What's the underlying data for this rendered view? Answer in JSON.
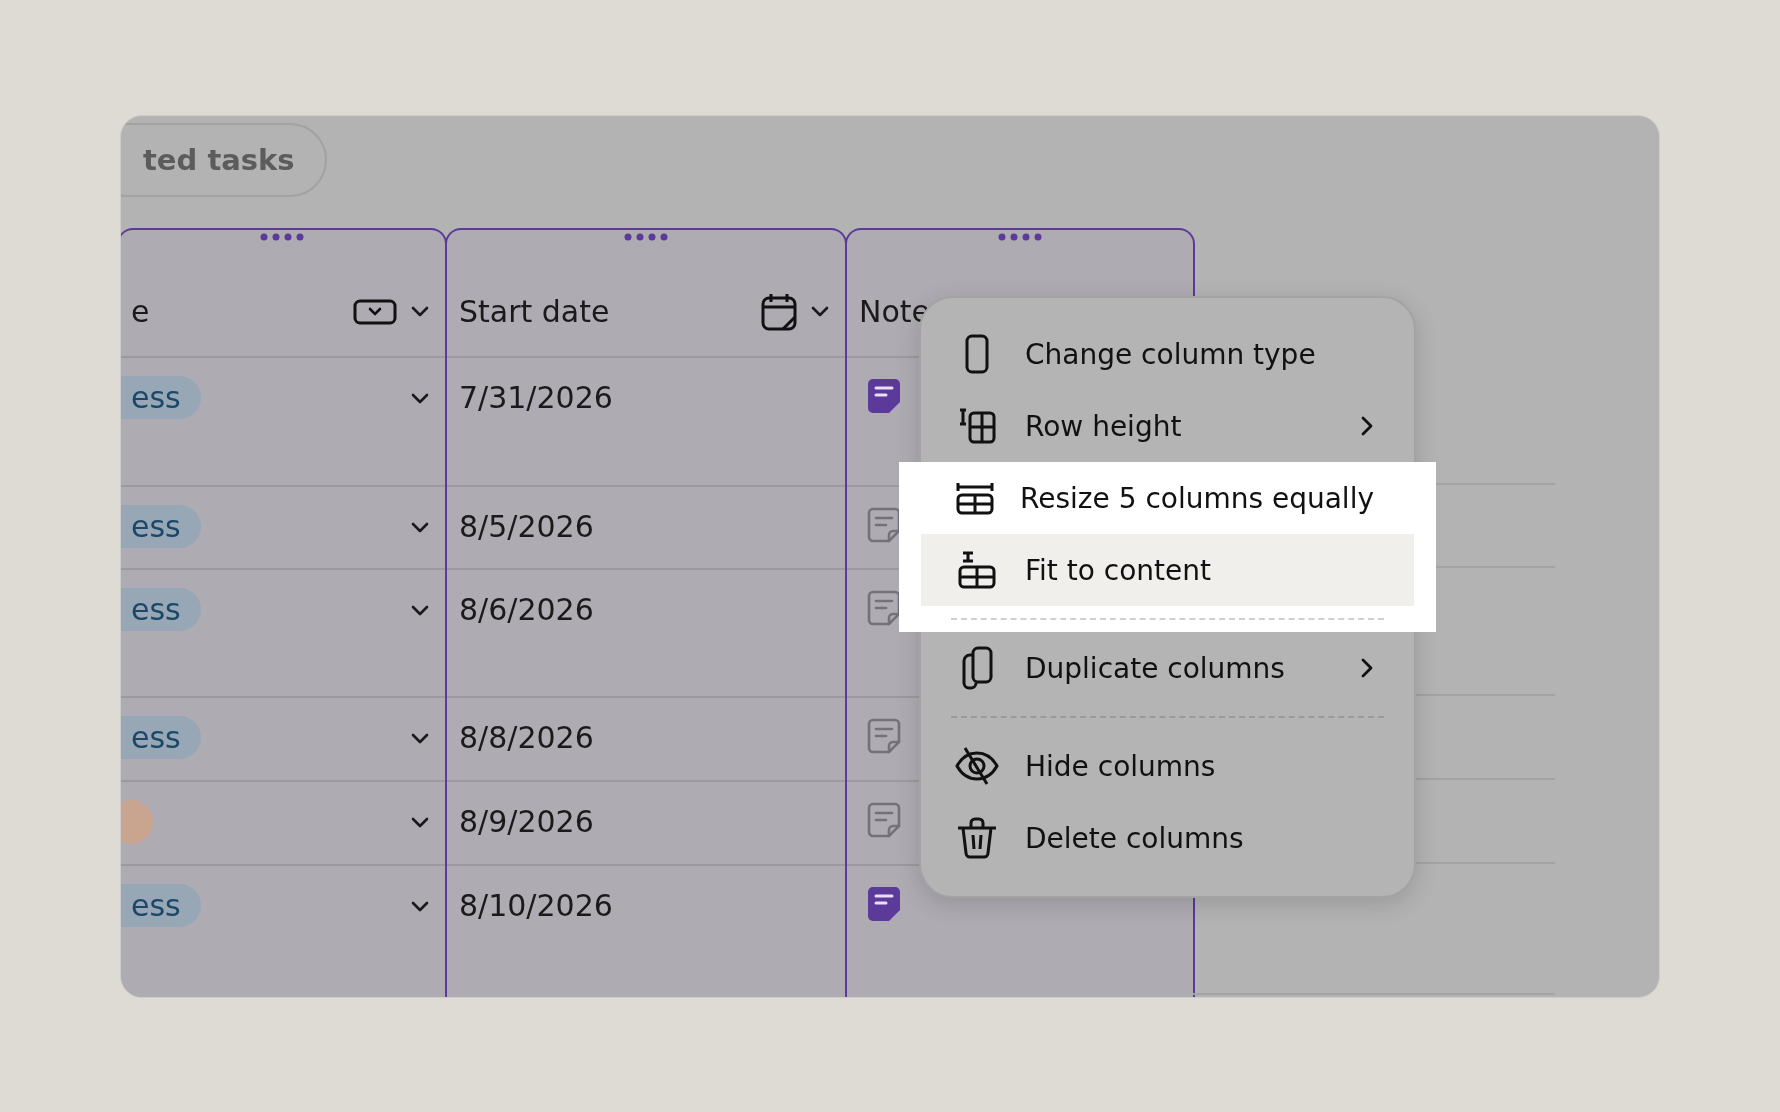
{
  "filter_pill": {
    "label": "ted tasks"
  },
  "columns": [
    {
      "header": "e",
      "selected": true,
      "cells": [
        {
          "kind": "status",
          "text": "ess"
        },
        {
          "kind": "status",
          "text": "ess"
        },
        {
          "kind": "status",
          "text": "ess"
        },
        {
          "kind": "status",
          "text": "ess"
        },
        {
          "kind": "dot",
          "color": "#c9a48e"
        },
        {
          "kind": "status",
          "text": "ess"
        }
      ]
    },
    {
      "header": "Start date",
      "selected": true,
      "cells": [
        {
          "kind": "date",
          "text": "7/31/2026"
        },
        {
          "kind": "date",
          "text": "8/5/2026"
        },
        {
          "kind": "date",
          "text": "8/6/2026"
        },
        {
          "kind": "date",
          "text": "8/8/2026"
        },
        {
          "kind": "date",
          "text": "8/9/2026"
        },
        {
          "kind": "date",
          "text": "8/10/2026"
        }
      ]
    },
    {
      "header": "Note",
      "selected": true,
      "cells": [
        {
          "kind": "note",
          "filled": true
        },
        {
          "kind": "note",
          "filled": false
        },
        {
          "kind": "note",
          "filled": false
        },
        {
          "kind": "note",
          "filled": false
        },
        {
          "kind": "note",
          "filled": false
        },
        {
          "kind": "note",
          "filled": true
        }
      ]
    }
  ],
  "menu": {
    "items": [
      {
        "kind": "item",
        "label": "Change column type",
        "submenu": false,
        "spotlight": false,
        "selected": false
      },
      {
        "kind": "item",
        "label": "Row height",
        "submenu": true,
        "spotlight": false,
        "selected": false
      },
      {
        "kind": "item",
        "label": "Resize 5 columns equally",
        "submenu": false,
        "spotlight": true,
        "selected": false
      },
      {
        "kind": "item",
        "label": "Fit to content",
        "submenu": false,
        "spotlight": true,
        "selected": true
      },
      {
        "kind": "divider",
        "spotlight": true
      },
      {
        "kind": "item",
        "label": "Duplicate columns",
        "submenu": true,
        "spotlight": false,
        "selected": false
      },
      {
        "kind": "divider",
        "spotlight": false
      },
      {
        "kind": "item",
        "label": "Hide columns",
        "submenu": false,
        "spotlight": false,
        "selected": false
      },
      {
        "kind": "item",
        "label": "Delete columns",
        "submenu": false,
        "spotlight": false,
        "selected": false
      }
    ]
  }
}
